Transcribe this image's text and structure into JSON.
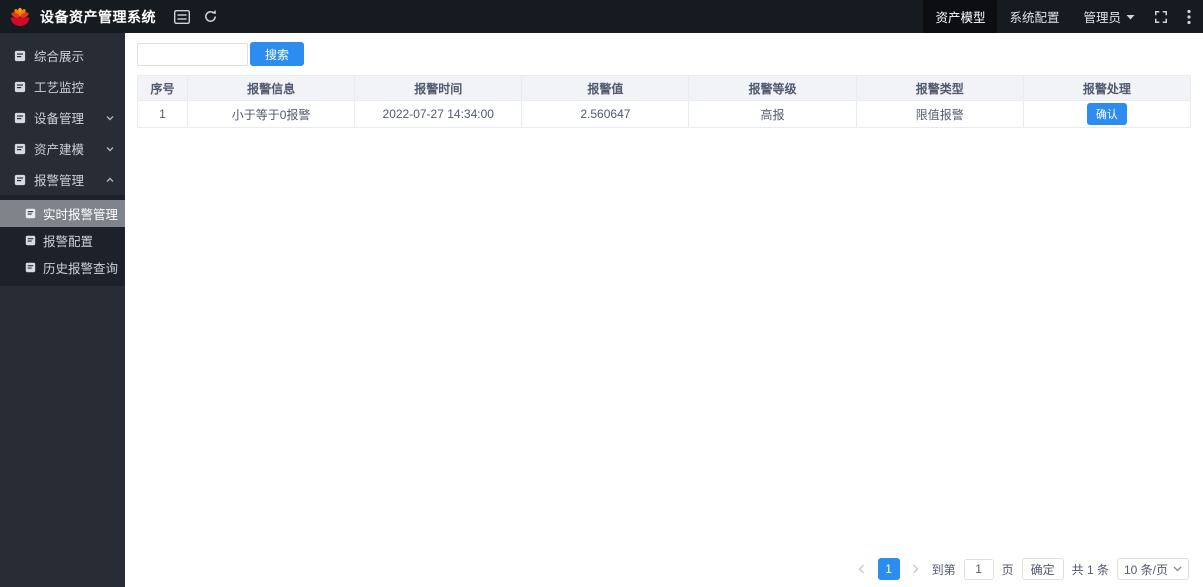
{
  "colors": {
    "topbar_bg": "#161a21",
    "topbar_active_bg": "#0c0e12",
    "sidebar_bg": "#272c35",
    "submenu_bg": "#1d212a",
    "submenu_active_bg": "#7f838a",
    "primary_blue": "#2d8cf0",
    "table_header_bg": "#f1f3f7",
    "table_border": "#e8ebf1",
    "text_dark": "#515a6e"
  },
  "topbar": {
    "title": "设备资产管理系统",
    "nav": [
      {
        "label": "资产模型",
        "active": true
      },
      {
        "label": "系统配置",
        "active": false
      }
    ],
    "user_label": "管理员"
  },
  "icons": {
    "logo": "petrochina-flower",
    "menu-list-icon": "☰",
    "refresh-icon": "⟳",
    "fullscreen-icon": "⛶",
    "more-vertical-icon": "⋮",
    "chevron-down-icon": "∨",
    "chevron-up-icon": "∧",
    "prev-page-icon": "‹",
    "next-page-icon": "›"
  },
  "sidebar": {
    "items": [
      {
        "label": "综合展示",
        "chevron": "none"
      },
      {
        "label": "工艺监控",
        "chevron": "none"
      },
      {
        "label": "设备管理",
        "chevron": "down"
      },
      {
        "label": "资产建模",
        "chevron": "down"
      },
      {
        "label": "报警管理",
        "chevron": "up",
        "expanded": true
      }
    ],
    "submenu": [
      {
        "label": "实时报警管理",
        "active": true
      },
      {
        "label": "报警配置",
        "active": false
      },
      {
        "label": "历史报警查询",
        "active": false
      }
    ]
  },
  "search": {
    "value": "",
    "button_label": "搜索"
  },
  "table": {
    "headers": [
      "序号",
      "报警信息",
      "报警时间",
      "报警值",
      "报警等级",
      "报警类型",
      "报警处理"
    ],
    "rows": [
      {
        "index": "1",
        "info": "小于等于0报警",
        "time": "2022-07-27 14:34:00",
        "value": "2.560647",
        "level": "高报",
        "type": "限值报警",
        "action_label": "确认"
      }
    ]
  },
  "pagination": {
    "current_page": "1",
    "goto_label": "到第",
    "goto_value": "1",
    "page_label": "页",
    "confirm_label": "确定",
    "total_label": "共 1 条",
    "page_size_label": "10 条/页"
  }
}
